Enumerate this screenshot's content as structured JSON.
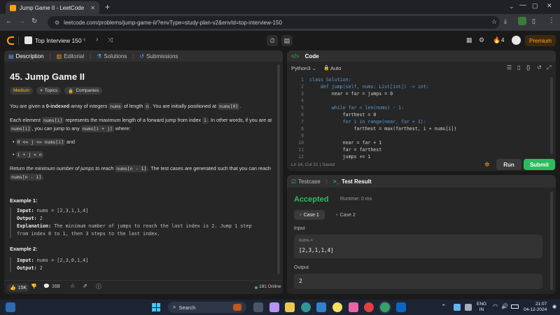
{
  "browser": {
    "tab_title": "Jump Game II - LeetCode",
    "url": "leetcode.com/problems/jump-game-ii/?envType=study-plan-v2&envId=top-interview-150"
  },
  "header": {
    "study_plan": "Top Interview 150",
    "streak": "4",
    "premium": "Premium"
  },
  "left_tabs": [
    "Description",
    "Editorial",
    "Solutions",
    "Submissions"
  ],
  "problem": {
    "title": "45. Jump Game II",
    "difficulty": "Medium",
    "topics": "Topics",
    "companies": "Companies",
    "p1a": "You are given a ",
    "p1b": "0-indexed",
    "p1c": " array of integers ",
    "p1code1": "nums",
    "p1d": " of length ",
    "p1code2": "n",
    "p1e": ". You are initially positioned at ",
    "p1code3": "nums[0]",
    "p1f": ".",
    "p2a": "Each element ",
    "p2code1": "nums[i]",
    "p2b": " represents the maximum length of a forward jump from index ",
    "p2code2": "i",
    "p2c": ". In other words, if you are at ",
    "p2code3": "nums[i]",
    "p2d": ", you can jump to any ",
    "p2code4": "nums[i + j]",
    "p2e": " where:",
    "b1code1": "0 <= j <= nums[i]",
    "b1text": " and",
    "b2code": "i + j < n",
    "p3a": "Return ",
    "p3b": "the minimum number of jumps to reach ",
    "p3code1": "nums[n - 1]",
    "p3c": ". The test cases are generated such that you can reach ",
    "p3code2": "nums[n - 1]",
    "p3d": ".",
    "ex1_title": "Example 1:",
    "ex1_input_label": "Input:",
    "ex1_input": " nums = [2,3,1,1,4]",
    "ex1_output_label": "Output:",
    "ex1_output": " 2",
    "ex1_expl_label": "Explanation:",
    "ex1_expl1": " The minimum number of jumps to reach the last index is 2. Jump 1 step",
    "ex1_expl2": "from index 0 to 1, then 3 steps to the last index.",
    "ex2_title": "Example 2:",
    "ex2_input_label": "Input:",
    "ex2_input": " nums = [2,3,0,1,4]",
    "ex2_output_label": "Output:",
    "ex2_output": " 2"
  },
  "footer_left": {
    "likes": "15K",
    "comments": "168",
    "online": "181 Online"
  },
  "code_panel": {
    "title": "Code",
    "language": "Python3",
    "auto": "Auto",
    "status_pos": "Ln 14, Col 21",
    "status_saved": "Saved",
    "run": "Run",
    "submit": "Submit",
    "lines": [
      {
        "n": "1",
        "t": "class Solution:"
      },
      {
        "n": "2",
        "t": "    def jump(self, nums: List[int]) -> int:"
      },
      {
        "n": "3",
        "t": "        near = far = jumps = 0"
      },
      {
        "n": "4",
        "t": ""
      },
      {
        "n": "5",
        "t": "        while far < len(nums) - 1:"
      },
      {
        "n": "6",
        "t": "            farthest = 0"
      },
      {
        "n": "7",
        "t": "            for i in range(near, far + 1):"
      },
      {
        "n": "8",
        "t": "                farthest = max(farthest, i + nums[i])"
      },
      {
        "n": "9",
        "t": ""
      },
      {
        "n": "10",
        "t": "            near = far + 1"
      },
      {
        "n": "11",
        "t": "            far = farthest"
      },
      {
        "n": "12",
        "t": "            jumps += 1"
      }
    ]
  },
  "test_panel": {
    "tab_testcase": "Testcase",
    "tab_result": "Test Result",
    "accepted": "Accepted",
    "runtime": "Runtime: 0 ms",
    "case1": "Case 1",
    "case2": "Case 2",
    "input_label": "Input",
    "input_var": "nums =",
    "input_value": "[2,3,1,1,4]",
    "output_label": "Output",
    "output_value": "2"
  },
  "taskbar": {
    "search": "Search",
    "lang1": "ENG",
    "lang2": "IN",
    "time": "21:07",
    "date": "04-12-2024"
  },
  "colors": {
    "accent_green": "#2cbb5d",
    "accent_orange": "#ffa116",
    "premium": "#d98a1d"
  }
}
